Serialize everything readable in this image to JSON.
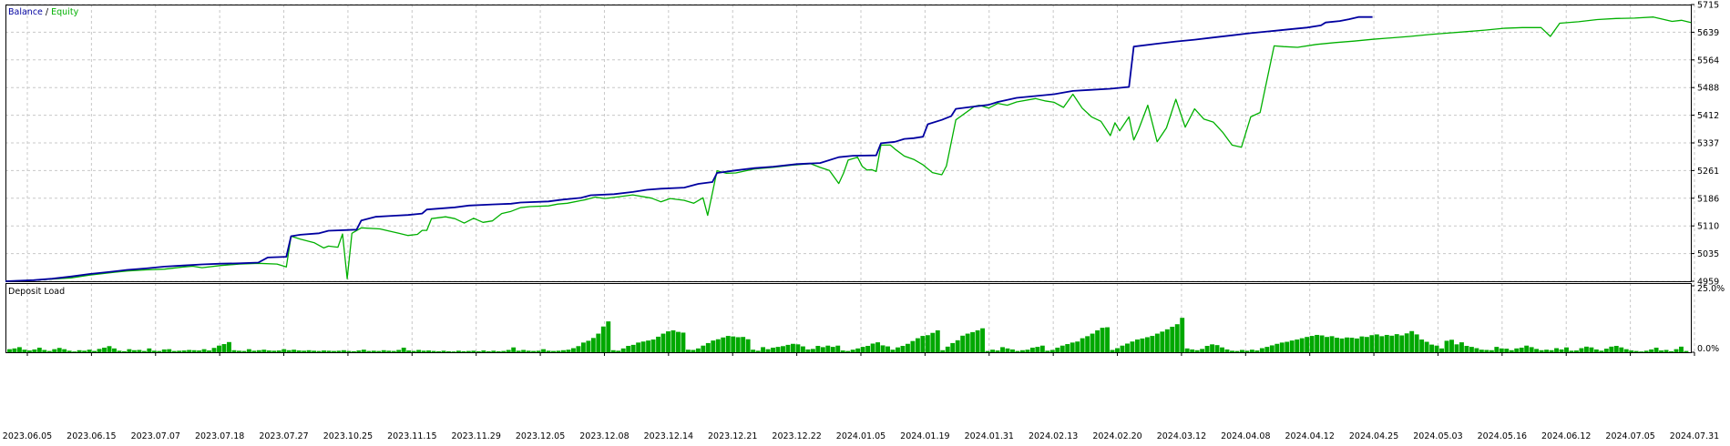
{
  "chart_data": [
    {
      "type": "line",
      "panel": "balance-equity",
      "legend": [
        {
          "label": "Balance",
          "color": "#0000a0"
        },
        {
          "label": "/",
          "color": "#000000"
        },
        {
          "label": "Equity",
          "color": "#00b000"
        }
      ],
      "ylim": [
        4959,
        5715
      ],
      "y_ticks": [
        "5715",
        "5639",
        "5564",
        "5488",
        "5412",
        "5337",
        "5261",
        "5186",
        "5110",
        "5035",
        "4959"
      ],
      "grid": true,
      "balance": [
        [
          0,
          4959
        ],
        [
          6,
          4962
        ],
        [
          10,
          4966
        ],
        [
          14,
          4972
        ],
        [
          18,
          4979
        ],
        [
          22,
          4984
        ],
        [
          26,
          4990
        ],
        [
          30,
          4994
        ],
        [
          34,
          4999
        ],
        [
          38,
          5002
        ],
        [
          42,
          5005
        ],
        [
          46,
          5007
        ],
        [
          50,
          5008
        ],
        [
          54,
          5010
        ],
        [
          56,
          5024
        ],
        [
          60,
          5026
        ],
        [
          61,
          5082
        ],
        [
          63,
          5086
        ],
        [
          67,
          5090
        ],
        [
          69,
          5097
        ],
        [
          75,
          5100
        ],
        [
          76,
          5125
        ],
        [
          79,
          5135
        ],
        [
          83,
          5138
        ],
        [
          86,
          5140
        ],
        [
          89,
          5144
        ],
        [
          90,
          5155
        ],
        [
          96,
          5161
        ],
        [
          99,
          5166
        ],
        [
          104,
          5169
        ],
        [
          108,
          5171
        ],
        [
          110,
          5174
        ],
        [
          116,
          5177
        ],
        [
          119,
          5182
        ],
        [
          123,
          5187
        ],
        [
          125,
          5194
        ],
        [
          130,
          5197
        ],
        [
          134,
          5203
        ],
        [
          137,
          5209
        ],
        [
          140,
          5212
        ],
        [
          145,
          5215
        ],
        [
          148,
          5225
        ],
        [
          151,
          5230
        ],
        [
          152,
          5255
        ],
        [
          156,
          5262
        ],
        [
          160,
          5268
        ],
        [
          164,
          5272
        ],
        [
          169,
          5279
        ],
        [
          174,
          5282
        ],
        [
          178,
          5298
        ],
        [
          181,
          5302
        ],
        [
          186,
          5303
        ],
        [
          187,
          5336
        ],
        [
          190,
          5340
        ],
        [
          192,
          5348
        ],
        [
          194,
          5350
        ],
        [
          196,
          5354
        ],
        [
          197,
          5388
        ],
        [
          200,
          5400
        ],
        [
          202,
          5410
        ],
        [
          203,
          5430
        ],
        [
          206,
          5435
        ],
        [
          210,
          5441
        ],
        [
          212,
          5449
        ],
        [
          216,
          5460
        ],
        [
          220,
          5465
        ],
        [
          224,
          5470
        ],
        [
          228,
          5479
        ],
        [
          232,
          5482
        ],
        [
          236,
          5485
        ],
        [
          240,
          5490
        ],
        [
          241,
          5600
        ],
        [
          246,
          5608
        ],
        [
          250,
          5614
        ],
        [
          254,
          5619
        ],
        [
          258,
          5625
        ],
        [
          262,
          5631
        ],
        [
          266,
          5637
        ],
        [
          270,
          5642
        ],
        [
          274,
          5647
        ],
        [
          278,
          5652
        ],
        [
          281,
          5658
        ],
        [
          282,
          5666
        ],
        [
          285,
          5670
        ],
        [
          287,
          5675
        ],
        [
          289,
          5681
        ],
        [
          292,
          5681
        ]
      ],
      "equity": [
        [
          0,
          4959
        ],
        [
          6,
          4962
        ],
        [
          10,
          4965
        ],
        [
          14,
          4968
        ],
        [
          18,
          4976
        ],
        [
          22,
          4982
        ],
        [
          26,
          4987
        ],
        [
          30,
          4990
        ],
        [
          34,
          4992
        ],
        [
          38,
          4998
        ],
        [
          40,
          5000
        ],
        [
          42,
          4996
        ],
        [
          46,
          5002
        ],
        [
          50,
          5006
        ],
        [
          54,
          5008
        ],
        [
          58,
          5006
        ],
        [
          60,
          4998
        ],
        [
          61,
          5082
        ],
        [
          63,
          5074
        ],
        [
          66,
          5064
        ],
        [
          68,
          5050
        ],
        [
          69,
          5055
        ],
        [
          71,
          5052
        ],
        [
          72,
          5088
        ],
        [
          73,
          4966
        ],
        [
          74,
          5090
        ],
        [
          76,
          5105
        ],
        [
          80,
          5102
        ],
        [
          84,
          5090
        ],
        [
          86,
          5084
        ],
        [
          88,
          5087
        ],
        [
          89,
          5098
        ],
        [
          90,
          5098
        ],
        [
          91,
          5130
        ],
        [
          94,
          5135
        ],
        [
          96,
          5130
        ],
        [
          98,
          5118
        ],
        [
          100,
          5131
        ],
        [
          102,
          5120
        ],
        [
          104,
          5124
        ],
        [
          106,
          5144
        ],
        [
          108,
          5150
        ],
        [
          110,
          5160
        ],
        [
          112,
          5163
        ],
        [
          116,
          5165
        ],
        [
          118,
          5170
        ],
        [
          120,
          5172
        ],
        [
          124,
          5182
        ],
        [
          126,
          5189
        ],
        [
          128,
          5185
        ],
        [
          130,
          5188
        ],
        [
          134,
          5195
        ],
        [
          138,
          5186
        ],
        [
          140,
          5176
        ],
        [
          142,
          5185
        ],
        [
          145,
          5180
        ],
        [
          147,
          5172
        ],
        [
          149,
          5187
        ],
        [
          150,
          5139
        ],
        [
          152,
          5261
        ],
        [
          154,
          5254
        ],
        [
          156,
          5255
        ],
        [
          160,
          5266
        ],
        [
          164,
          5270
        ],
        [
          168,
          5276
        ],
        [
          172,
          5280
        ],
        [
          174,
          5270
        ],
        [
          176,
          5262
        ],
        [
          178,
          5226
        ],
        [
          179,
          5254
        ],
        [
          180,
          5290
        ],
        [
          182,
          5298
        ],
        [
          183,
          5273
        ],
        [
          184,
          5263
        ],
        [
          185,
          5264
        ],
        [
          186,
          5259
        ],
        [
          187,
          5331
        ],
        [
          189,
          5331
        ],
        [
          190,
          5320
        ],
        [
          192,
          5301
        ],
        [
          194,
          5292
        ],
        [
          196,
          5277
        ],
        [
          198,
          5256
        ],
        [
          200,
          5250
        ],
        [
          201,
          5274
        ],
        [
          203,
          5400
        ],
        [
          207,
          5437
        ],
        [
          208,
          5440
        ],
        [
          210,
          5432
        ],
        [
          212,
          5445
        ],
        [
          214,
          5440
        ],
        [
          216,
          5449
        ],
        [
          220,
          5458
        ],
        [
          222,
          5452
        ],
        [
          224,
          5448
        ],
        [
          226,
          5434
        ],
        [
          228,
          5470
        ],
        [
          230,
          5432
        ],
        [
          232,
          5408
        ],
        [
          234,
          5396
        ],
        [
          236,
          5357
        ],
        [
          237,
          5392
        ],
        [
          238,
          5370
        ],
        [
          240,
          5408
        ],
        [
          241,
          5345
        ],
        [
          242,
          5372
        ],
        [
          244,
          5440
        ],
        [
          246,
          5340
        ],
        [
          248,
          5378
        ],
        [
          250,
          5456
        ],
        [
          252,
          5380
        ],
        [
          254,
          5430
        ],
        [
          256,
          5402
        ],
        [
          258,
          5394
        ],
        [
          260,
          5366
        ],
        [
          262,
          5331
        ],
        [
          264,
          5325
        ],
        [
          266,
          5408
        ],
        [
          268,
          5420
        ],
        [
          271,
          5602
        ],
        [
          273,
          5600
        ],
        [
          276,
          5598
        ],
        [
          280,
          5606
        ],
        [
          284,
          5611
        ],
        [
          288,
          5615
        ],
        [
          292,
          5620
        ],
        [
          296,
          5624
        ],
        [
          300,
          5628
        ],
        [
          304,
          5633
        ],
        [
          308,
          5637
        ],
        [
          312,
          5641
        ],
        [
          316,
          5645
        ],
        [
          320,
          5650
        ],
        [
          324,
          5652
        ],
        [
          328,
          5652
        ],
        [
          330,
          5628
        ],
        [
          332,
          5664
        ],
        [
          336,
          5668
        ],
        [
          340,
          5674
        ],
        [
          344,
          5677
        ],
        [
          348,
          5678
        ],
        [
          352,
          5681
        ],
        [
          354,
          5675
        ],
        [
          356,
          5669
        ],
        [
          358,
          5672
        ],
        [
          360,
          5666
        ]
      ]
    },
    {
      "type": "bar",
      "panel": "deposit-load",
      "title": "Deposit Load",
      "color": "#00a800",
      "ylim": [
        0,
        25
      ],
      "y_ticks": [
        "25.0%",
        "0.0%"
      ],
      "x_tick_labels": [
        "2023.06.05",
        "2023.06.15",
        "2023.07.07",
        "2023.07.18",
        "2023.07.27",
        "2023.10.25",
        "2023.11.15",
        "2023.11.29",
        "2023.12.05",
        "2023.12.08",
        "2023.12.14",
        "2023.12.21",
        "2023.12.22",
        "2024.01.05",
        "2024.01.19",
        "2024.01.31",
        "2024.02.13",
        "2024.02.20",
        "2024.03.12",
        "2024.04.08",
        "2024.04.12",
        "2024.04.25",
        "2024.05.03",
        "2024.05.16",
        "2024.06.12",
        "2024.07.05",
        "2024.07.31"
      ],
      "values": [
        1.2,
        1.5,
        2.0,
        1.0,
        0.7,
        1.1,
        1.8,
        0.9,
        0.5,
        1.2,
        1.7,
        1.2,
        0.6,
        0.3,
        0.8,
        0.6,
        1.0,
        0.5,
        1.3,
        1.8,
        2.4,
        1.5,
        0.6,
        0.4,
        1.2,
        0.8,
        0.9,
        0.5,
        1.5,
        0.6,
        0.5,
        1.1,
        1.2,
        0.5,
        0.6,
        0.7,
        0.9,
        0.8,
        0.7,
        1.2,
        0.7,
        1.7,
        2.6,
        3.2,
        4.0,
        0.8,
        0.6,
        0.5,
        1.2,
        0.6,
        0.8,
        1.0,
        0.7,
        0.6,
        0.7,
        1.2,
        0.8,
        1.0,
        0.7,
        0.6,
        0.8,
        0.6,
        0.5,
        0.7,
        0.6,
        0.5,
        0.6,
        0.8,
        0.5,
        0.4,
        0.7,
        1.0,
        0.5,
        0.6,
        0.5,
        0.8,
        0.6,
        0.5,
        0.9,
        1.8,
        0.7,
        0.5,
        0.9,
        0.6,
        0.7,
        0.5,
        0.4,
        0.6,
        0.4,
        0.3,
        0.6,
        0.4,
        0.5,
        0.6,
        0.4,
        0.7,
        0.4,
        0.6,
        0.4,
        0.5,
        0.9,
        1.9,
        0.6,
        0.9,
        0.6,
        0.5,
        0.6,
        1.2,
        0.6,
        0.5,
        0.6,
        0.8,
        1.0,
        1.6,
        2.4,
        3.8,
        4.5,
        5.6,
        7.3,
        10.1,
        12.1,
        0.8,
        0.6,
        1.5,
        2.5,
        2.9,
        3.8,
        4.2,
        4.6,
        5.0,
        6.1,
        7.3,
        8.2,
        8.6,
        8.0,
        7.7,
        1.0,
        0.9,
        1.5,
        2.6,
        3.6,
        4.6,
        5.1,
        5.8,
        6.4,
        6.2,
        5.9,
        6.0,
        5.1,
        1.0,
        0.6,
        2.0,
        1.2,
        1.8,
        2.1,
        2.4,
        2.9,
        3.3,
        3.1,
        2.3,
        1.1,
        1.3,
        2.5,
        2.0,
        2.6,
        2.1,
        2.6,
        0.7,
        0.5,
        1.0,
        1.5,
        2.1,
        2.5,
        3.4,
        3.9,
        2.7,
        2.3,
        1.0,
        1.9,
        2.5,
        3.3,
        4.4,
        5.5,
        6.4,
        6.7,
        7.6,
        8.6,
        0.8,
        2.2,
        3.6,
        4.7,
        6.5,
        7.3,
        7.9,
        8.6,
        9.4,
        0.5,
        1.0,
        0.7,
        2.0,
        1.5,
        1.1,
        0.5,
        0.8,
        1.0,
        1.8,
        2.1,
        2.6,
        0.6,
        0.9,
        1.8,
        2.6,
        3.2,
        3.8,
        4.2,
        5.5,
        6.3,
        7.3,
        8.6,
        9.6,
        9.8,
        0.9,
        1.6,
        2.6,
        3.4,
        4.2,
        5.0,
        5.4,
        5.9,
        6.4,
        7.3,
        8.1,
        9.0,
        10.0,
        11.0,
        13.5,
        1.5,
        1.1,
        0.8,
        1.3,
        2.5,
        3.1,
        2.8,
        1.9,
        1.1,
        0.6,
        0.5,
        0.9,
        0.6,
        1.0,
        0.7,
        1.6,
        2.1,
        2.7,
        3.3,
        3.8,
        4.1,
        4.6,
        5.0,
        5.5,
        6.0,
        6.4,
        6.8,
        6.6,
        6.0,
        6.3,
        5.7,
        5.4,
        5.8,
        5.7,
        5.4,
        6.2,
        6.0,
        6.7,
        7.0,
        6.3,
        6.8,
        6.5,
        7.1,
        6.6,
        7.4,
        8.3,
        7.0,
        5.0,
        4.1,
        3.0,
        2.6,
        1.5,
        4.5,
        4.9,
        3.1,
        3.9,
        2.5,
        2.1,
        1.6,
        1.0,
        0.9,
        0.8,
        2.1,
        1.5,
        1.4,
        0.8,
        1.5,
        1.8,
        2.6,
        2.0,
        1.3,
        0.8,
        1.0,
        0.8,
        1.6,
        1.1,
        1.9,
        0.6,
        0.7,
        1.6,
        2.2,
        1.9,
        1.1,
        0.6,
        1.4,
        2.2,
        2.5,
        1.9,
        1.2,
        0.7,
        0.5,
        0.3,
        0.6,
        1.1,
        1.8,
        0.7,
        0.9,
        0.4,
        1.2,
        2.2,
        0.5
      ]
    }
  ]
}
